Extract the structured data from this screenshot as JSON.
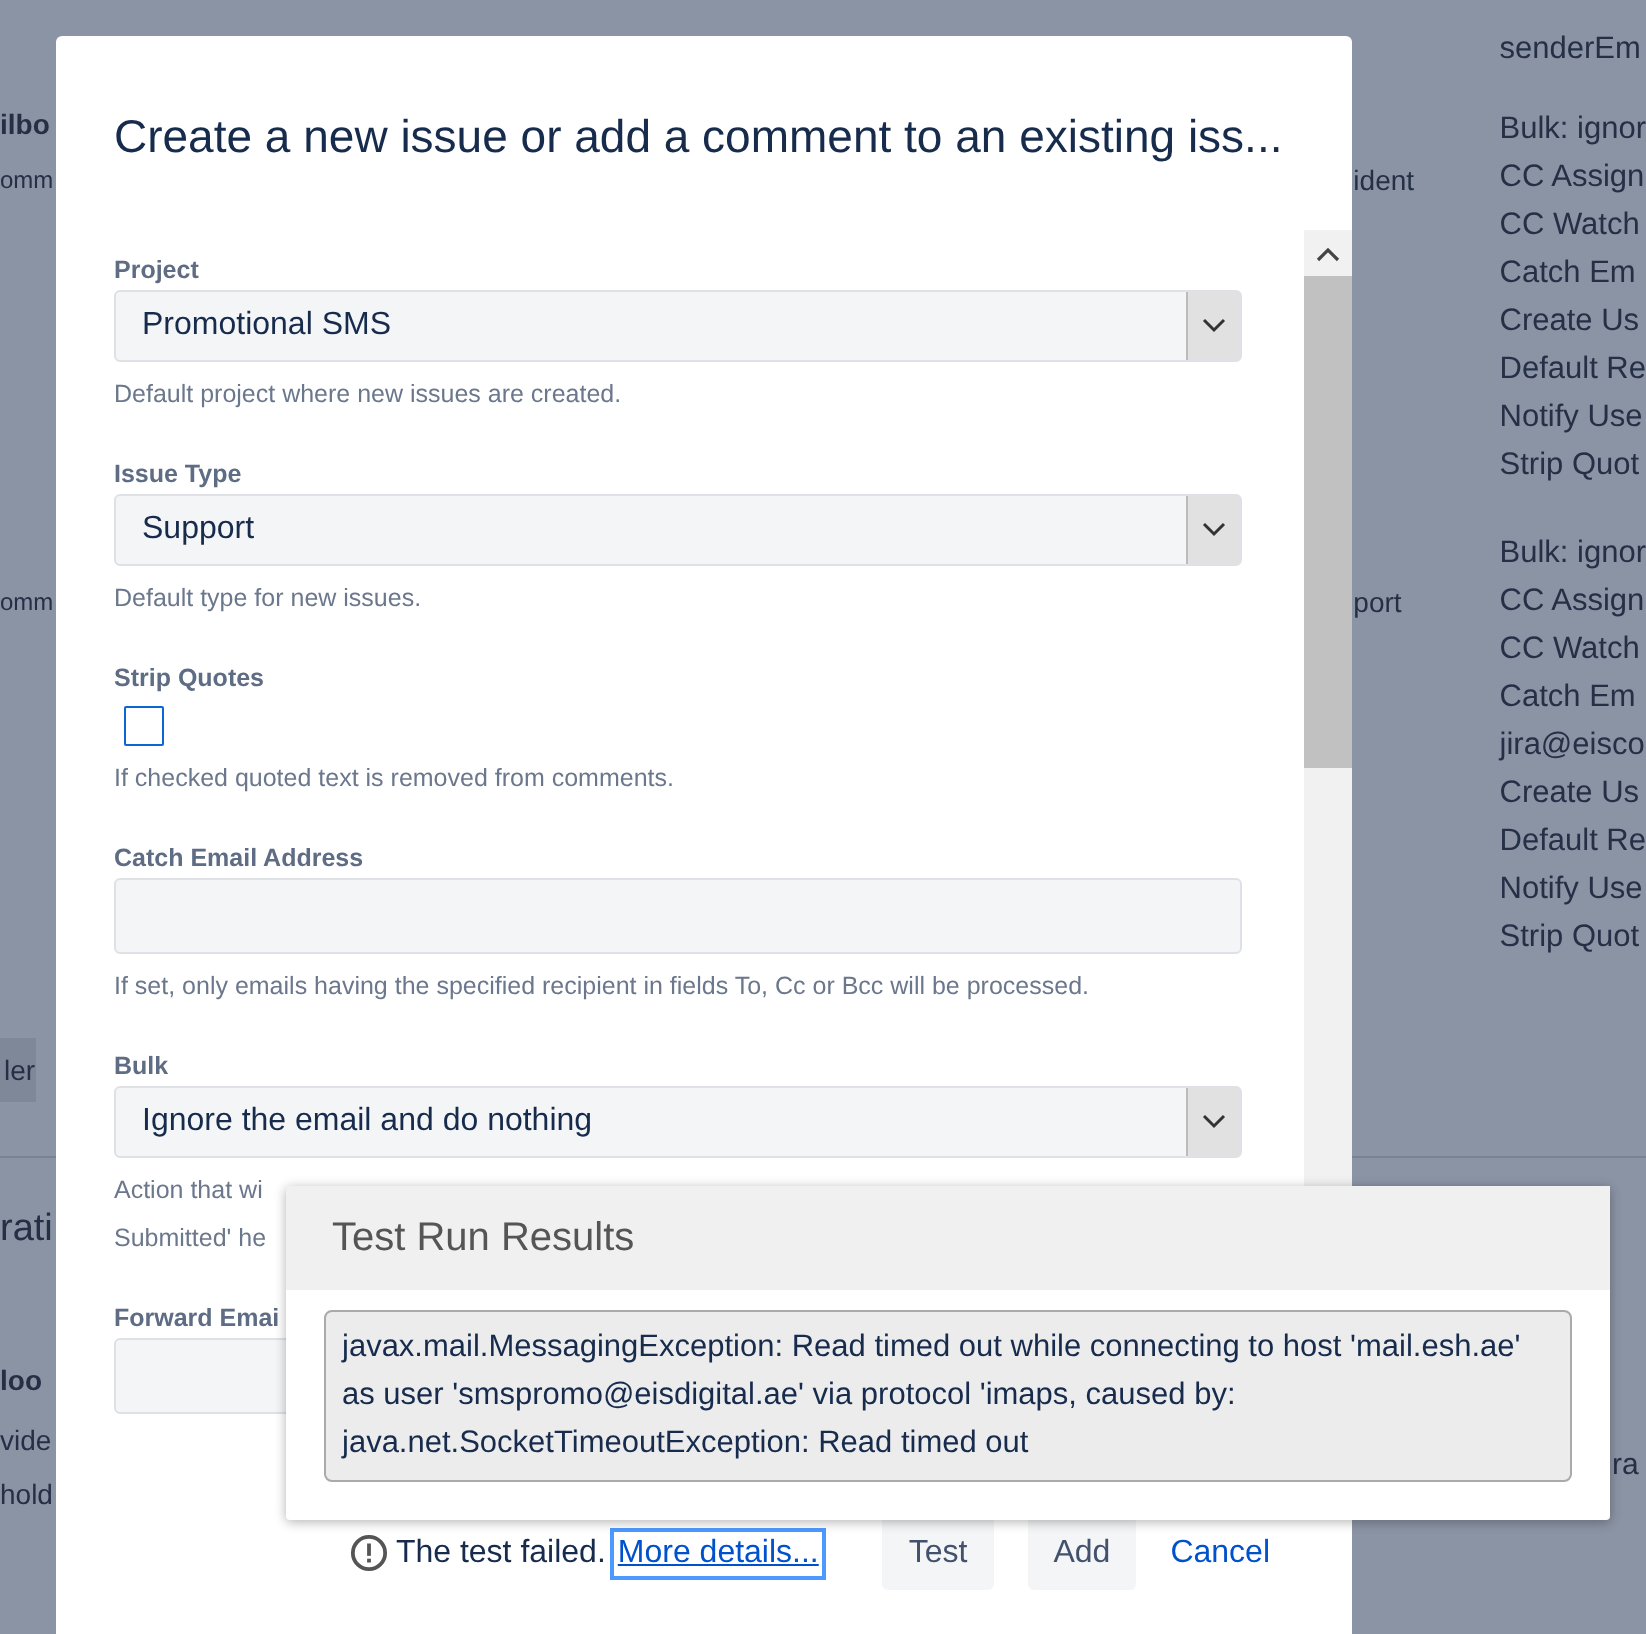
{
  "background": {
    "left_fragments": [
      {
        "kind": "bold",
        "text": "ilbo"
      },
      {
        "kind": "small",
        "text": "omm"
      },
      {
        "kind": "small",
        "text": "omm"
      },
      {
        "kind": "tab",
        "text": "ler"
      },
      {
        "kind": "heading",
        "text": "rati"
      },
      {
        "kind": "bold",
        "text": "loo"
      },
      {
        "kind": "plain",
        "text": "vide"
      },
      {
        "kind": "plain",
        "text": "hold"
      }
    ],
    "middle_fragments": [
      "ident",
      "port"
    ],
    "right_groups": [
      [
        "senderEm"
      ],
      [
        "Bulk: ignor",
        "CC Assign",
        "CC Watch",
        "Catch Em",
        "Create Us",
        "Default Re",
        "Notify Use",
        "Strip Quot"
      ],
      [
        "Bulk: ignor",
        "CC Assign",
        "CC Watch",
        "Catch Em",
        "jira@eisco",
        "Create Us",
        "Default Re",
        "Notify Use",
        "Strip Quot"
      ]
    ],
    "right_edge": "ra"
  },
  "dialog": {
    "title": "Create a new issue or add a comment to an existing iss...",
    "fields": [
      {
        "kind": "select",
        "label": "Project",
        "value": "Promotional SMS",
        "help": [
          "Default project where new issues are created."
        ]
      },
      {
        "kind": "select",
        "label": "Issue Type",
        "value": "Support",
        "help": [
          "Default type for new issues."
        ]
      },
      {
        "kind": "checkbox",
        "label": "Strip Quotes",
        "checked": false,
        "help": [
          "If checked quoted text is removed from comments."
        ]
      },
      {
        "kind": "text",
        "label": "Catch Email Address",
        "help": [
          "If set, only emails having the specified recipient in fields To, Cc or Bcc will be processed."
        ]
      },
      {
        "kind": "select",
        "label": "Bulk",
        "value": "Ignore the email and do nothing",
        "help": [
          "Action that wi",
          "Submitted' he"
        ]
      },
      {
        "kind": "text",
        "label": "Forward Emai"
      }
    ],
    "footer": {
      "status": "The test failed.",
      "link": "More details...",
      "buttons": [
        "Test",
        "Add"
      ],
      "cancel": "Cancel"
    }
  },
  "popup": {
    "title": "Test Run Results",
    "message": "javax.mail.MessagingException: Read timed out while connecting to host 'mail.esh.ae' as user 'smspromo@eisdigital.ae' via protocol 'imaps, caused by: java.net.SocketTimeoutException: Read timed out"
  }
}
